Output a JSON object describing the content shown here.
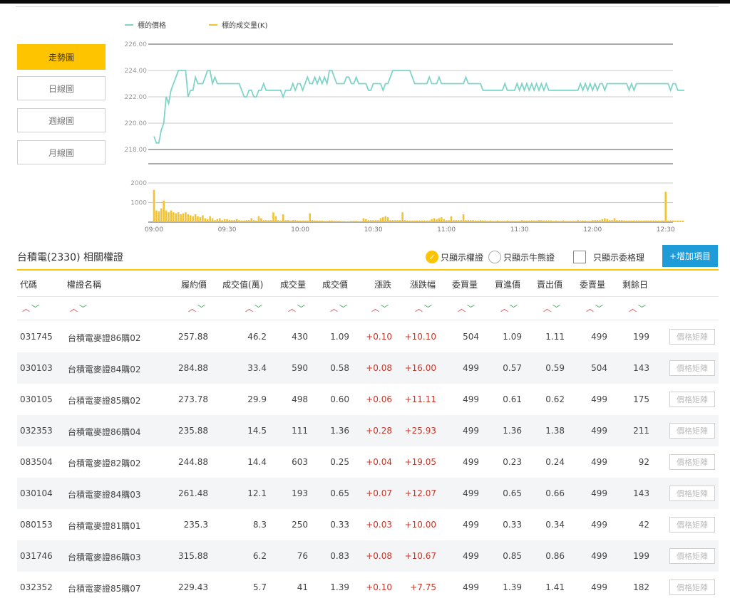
{
  "tabs": [
    {
      "label": "走勢圖",
      "active": true
    },
    {
      "label": "日線圖",
      "active": false
    },
    {
      "label": "週線圖",
      "active": false
    },
    {
      "label": "月線圖",
      "active": false
    }
  ],
  "colors": {
    "accent": "#ffc400",
    "price_line": "#7fd3c8",
    "volume_bar": "#f2c230",
    "button_blue": "#1f9bd7",
    "up_red": "#cc3333",
    "down_green": "#2e9e4f"
  },
  "chart_data": {
    "type": "line",
    "legend": [
      {
        "name": "標的價格",
        "color": "#7fd3c8"
      },
      {
        "name": "標的成交量(K)",
        "color": "#f2c230"
      }
    ],
    "price_axis": {
      "ticks": [
        "226.00",
        "224.00",
        "222.00",
        "220.00",
        "218.00"
      ],
      "ylim": [
        218,
        226
      ]
    },
    "volume_axis": {
      "ticks": [
        "2000",
        "1000"
      ],
      "ylim": [
        0,
        2000
      ]
    },
    "x_ticks": [
      "09:00",
      "09:30",
      "10:00",
      "10:30",
      "11:00",
      "11:30",
      "12:00",
      "12:30"
    ],
    "x_range_minutes": [
      0,
      213
    ],
    "price": [
      219,
      218.5,
      218.5,
      219.5,
      220,
      222,
      221.5,
      222.5,
      223,
      223.5,
      224,
      224,
      224,
      224,
      222,
      222.5,
      222.5,
      223.5,
      223,
      223,
      223,
      223.5,
      224,
      224,
      223,
      223.5,
      223,
      223,
      223,
      223,
      223,
      223,
      223,
      223,
      223,
      223,
      222.5,
      222,
      222,
      222.5,
      222.5,
      222,
      222,
      222.5,
      222.5,
      223,
      222.5,
      222.5,
      222.5,
      222.5,
      222.5,
      222.5,
      222.5,
      222,
      222.5,
      222.5,
      222.5,
      223,
      222.5,
      223,
      223,
      222.5,
      223,
      223.5,
      223,
      223,
      223.5,
      223,
      223.5,
      223,
      223.5,
      223,
      224,
      224,
      223.5,
      223,
      223,
      223,
      223,
      223.5,
      223.5,
      223,
      223,
      223.5,
      223,
      223,
      223,
      223,
      222.5,
      222.5,
      223,
      223,
      223,
      223,
      222.5,
      223,
      223,
      223.5,
      224,
      224,
      224,
      224,
      224,
      224,
      224,
      224,
      223.5,
      223,
      223,
      223,
      223,
      223,
      223,
      223.5,
      223,
      223,
      223,
      223.5,
      223,
      223,
      223,
      223,
      223,
      223,
      223,
      223,
      223,
      223,
      223.5,
      223,
      223,
      223,
      223,
      223,
      223,
      222.5,
      222.5,
      222.5,
      222.5,
      222.5,
      222.5,
      222.5,
      222.5,
      222.5,
      223,
      222.5,
      222.5,
      222.5,
      222.5,
      223,
      222.5,
      223,
      222.5,
      223,
      222.5,
      223,
      222.5,
      223,
      222.5,
      223,
      222.5,
      223,
      222.5,
      222.5,
      222.5,
      222.5,
      222.5,
      222.5,
      222.5,
      222.5,
      222.5,
      222.5,
      222.5,
      222.5,
      222.5,
      223,
      222.5,
      223,
      222.5,
      223,
      222.5,
      223,
      222.5,
      223,
      223,
      222.5,
      223,
      223,
      223,
      223,
      223,
      223,
      223,
      223,
      223,
      222.5,
      223,
      222.5,
      223,
      223,
      223,
      223,
      223,
      223,
      223,
      223,
      223,
      223,
      223,
      223,
      223,
      223,
      222.5,
      223,
      223,
      222.5,
      222.5,
      222.5,
      222.5,
      222.5,
      222.5,
      223,
      223.5,
      223.5,
      223.5,
      223,
      223.5,
      223.5,
      223
    ],
    "volume": [
      1650,
      600,
      550,
      700,
      1100,
      600,
      500,
      600,
      500,
      450,
      500,
      400,
      450,
      500,
      400,
      350,
      300,
      400,
      300,
      250,
      350,
      200,
      150,
      300,
      200,
      100,
      150,
      200,
      100,
      150,
      150,
      120,
      100,
      100,
      150,
      100,
      80,
      80,
      100,
      100,
      200,
      100,
      80,
      300,
      200,
      100,
      100,
      100,
      100,
      500,
      300,
      100,
      80,
      400,
      100,
      100,
      80,
      100,
      100,
      80,
      80,
      80,
      80,
      80,
      450,
      100,
      80,
      80,
      80,
      80,
      60,
      60,
      80,
      80,
      60,
      60,
      60,
      50,
      50,
      40,
      40,
      60,
      60,
      60,
      50,
      50,
      200,
      150,
      100,
      100,
      100,
      100,
      100,
      200,
      250,
      300,
      250,
      100,
      100,
      100,
      100,
      100,
      500,
      100,
      80,
      80,
      80,
      80,
      80,
      80,
      80,
      80,
      80,
      80,
      150,
      200,
      150,
      200,
      250,
      150,
      100,
      100,
      300,
      100,
      100,
      100,
      100,
      400,
      100,
      100,
      100,
      100,
      80,
      80,
      100,
      80,
      80,
      60,
      80,
      60,
      60,
      80,
      60,
      60,
      60,
      80,
      60,
      60,
      60,
      60,
      60,
      100,
      80,
      80,
      80,
      80,
      80,
      80,
      100,
      100,
      80,
      80,
      80,
      80,
      60,
      80,
      60,
      60,
      80,
      60,
      60,
      60,
      60,
      60,
      100,
      60,
      80,
      80,
      60,
      60,
      100,
      100,
      100,
      100,
      150,
      200,
      150,
      100,
      100,
      200,
      100,
      100,
      100,
      80,
      80,
      80,
      80,
      80,
      80,
      80,
      80,
      80,
      80,
      80,
      80,
      80,
      80,
      80,
      80,
      80,
      1550,
      80,
      80,
      80,
      80,
      80,
      80,
      80,
      80,
      80,
      80,
      80,
      1400,
      200,
      80
    ]
  },
  "section": {
    "title": "台積電(2330) 相關權證",
    "opt_warrant": "只顯示權證",
    "opt_bullbear": "只顯示牛熊證",
    "opt_market_maker": "只顯示委格理",
    "add_button": "+增加項目"
  },
  "table": {
    "headers": [
      "代碼",
      "權證名稱",
      "履約價",
      "成交值(萬)",
      "成交量",
      "成交價",
      "漲跌",
      "漲跌幅",
      "委買量",
      "買進價",
      "賣出價",
      "委賣量",
      "剩餘日"
    ],
    "action_label": "價格矩陣",
    "rows": [
      [
        "031745",
        "台積電麥證86購02",
        "257.88",
        "46.2",
        "430",
        "1.09",
        "+0.10",
        "+10.10",
        "504",
        "1.09",
        "1.11",
        "499",
        "199"
      ],
      [
        "030103",
        "台積電麥證84購02",
        "284.88",
        "33.4",
        "590",
        "0.58",
        "+0.08",
        "+16.00",
        "499",
        "0.57",
        "0.59",
        "504",
        "143"
      ],
      [
        "030105",
        "台積電麥證85購02",
        "273.78",
        "29.9",
        "498",
        "0.60",
        "+0.06",
        "+11.11",
        "499",
        "0.61",
        "0.62",
        "499",
        "175"
      ],
      [
        "032353",
        "台積電麥證86購04",
        "235.88",
        "14.5",
        "111",
        "1.36",
        "+0.28",
        "+25.93",
        "499",
        "1.36",
        "1.38",
        "499",
        "211"
      ],
      [
        "083504",
        "台積電麥證82購02",
        "244.88",
        "14.4",
        "603",
        "0.25",
        "+0.04",
        "+19.05",
        "499",
        "0.23",
        "0.24",
        "499",
        "92"
      ],
      [
        "030104",
        "台積電麥證84購03",
        "261.48",
        "12.1",
        "193",
        "0.65",
        "+0.07",
        "+12.07",
        "499",
        "0.65",
        "0.66",
        "499",
        "143"
      ],
      [
        "080153",
        "台積電麥證81購01",
        "235.3",
        "8.3",
        "250",
        "0.33",
        "+0.03",
        "+10.00",
        "499",
        "0.33",
        "0.34",
        "499",
        "42"
      ],
      [
        "031746",
        "台積電麥證86購03",
        "315.88",
        "6.2",
        "76",
        "0.83",
        "+0.08",
        "+10.67",
        "499",
        "0.85",
        "0.86",
        "499",
        "199"
      ],
      [
        "032352",
        "台積電麥證85購07",
        "229.43",
        "5.7",
        "41",
        "1.39",
        "+0.10",
        "+7.75",
        "499",
        "1.39",
        "1.41",
        "499",
        "182"
      ]
    ]
  }
}
